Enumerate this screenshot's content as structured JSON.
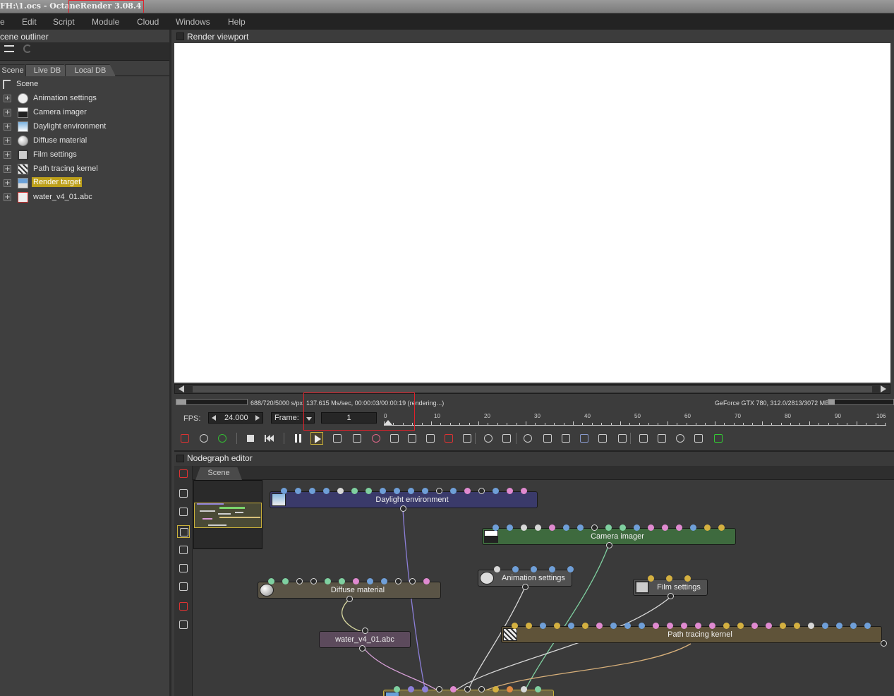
{
  "window": {
    "title": "FH:\\1.ocs - OctaneRender 3.08.4"
  },
  "menu": [
    "e",
    "Edit",
    "Script",
    "Module",
    "Cloud",
    "Windows",
    "Help"
  ],
  "outliner": {
    "title": "cene outliner",
    "tabs": [
      "Scene",
      "Live DB",
      "Local DB"
    ],
    "root": "Scene",
    "items": [
      {
        "label": "Animation settings",
        "icon": "clock-icon"
      },
      {
        "label": "Camera imager",
        "icon": "image-icon"
      },
      {
        "label": "Daylight environment",
        "icon": "environment-icon"
      },
      {
        "label": "Diffuse material",
        "icon": "sphere-icon"
      },
      {
        "label": "Film settings",
        "icon": "film-icon"
      },
      {
        "label": "Path tracing kernel",
        "icon": "kernel-icon"
      },
      {
        "label": "Render target",
        "icon": "render-target-icon",
        "selected": true
      },
      {
        "label": "water_v4_01.abc",
        "icon": "alembic-icon"
      }
    ]
  },
  "viewport": {
    "title": "Render viewport",
    "status": "688/720/5000 s/px, 137.615 Ms/sec, 00:00:03/00:00:19 (rendering...)",
    "gpu": "GeForce GTX 780, 312.0/2813/3072 MB",
    "progress": 0.1376,
    "gpu_usage": 0.1
  },
  "timeline": {
    "fps_label": "FPS:",
    "fps_value": "24.000",
    "frame_label": "Frame:",
    "frame_value": "1",
    "ticks": [
      "0",
      "10",
      "20",
      "30",
      "40",
      "50",
      "60",
      "70",
      "80",
      "90",
      "106"
    ]
  },
  "nodegraph": {
    "title": "Nodegraph editor",
    "tab": "Scene",
    "nodes": {
      "daylight": "Daylight environment",
      "camera": "Camera imager",
      "animation": "Animation settings",
      "film": "Film settings",
      "diffuse": "Diffuse material",
      "water": "water_v4_01.abc",
      "kernel": "Path tracing kernel"
    }
  },
  "colors": {
    "selected": "#bda01b",
    "highlight_box": "#e0202a"
  }
}
